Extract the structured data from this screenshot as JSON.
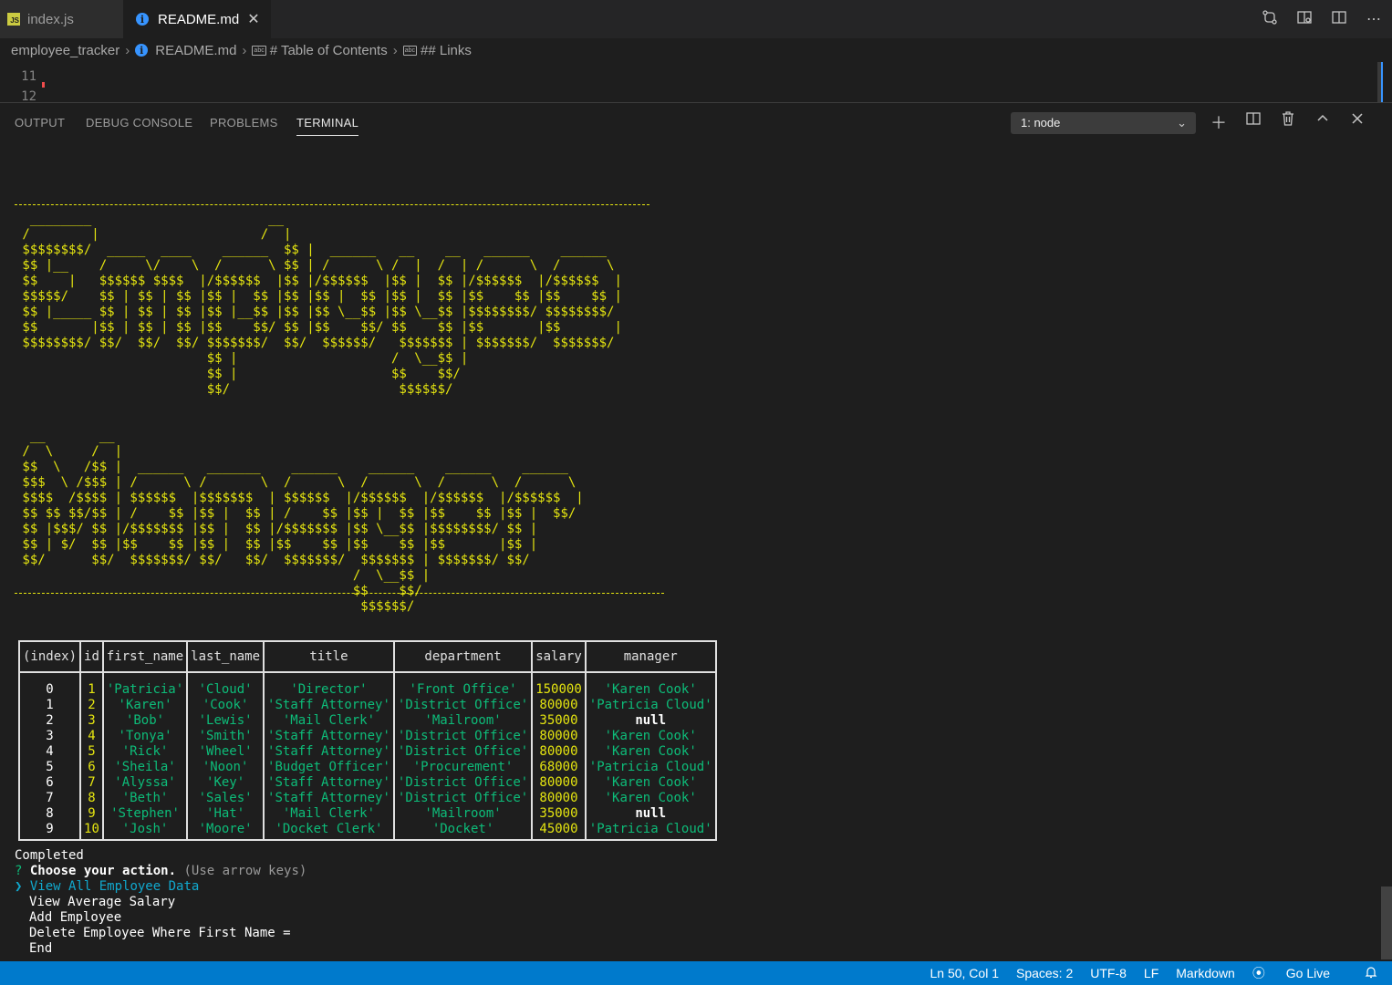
{
  "tabs": [
    {
      "label": "index.js",
      "icon": "js-file-icon"
    },
    {
      "label": "README.md",
      "icon": "info-icon",
      "close": "✕"
    }
  ],
  "breadcrumbs": {
    "folder": "employee_tracker",
    "file": "README.md",
    "section1": "# Table of Contents",
    "section2": "## Links"
  },
  "editor": {
    "line_numbers": [
      "11",
      "12"
    ]
  },
  "panel": {
    "tabs": [
      "OUTPUT",
      "DEBUG CONSOLE",
      "PROBLEMS",
      "TERMINAL"
    ],
    "active_tab": "TERMINAL",
    "terminal_select": "1: node"
  },
  "terminal": {
    "art_lines": [
      "  ________                       __",
      " /        |                     /  |",
      " $$$$$$$$/  _____  ____    ______  $$ |  ______   __    __   ______    ______",
      " $$ |__    /     \\/    \\  /      \\ $$ | /      \\ /  |  /  | /      \\  /      \\",
      " $$    |   $$$$$$ $$$$  |/$$$$$$  |$$ |/$$$$$$  |$$ |  $$ |/$$$$$$  |/$$$$$$  |",
      " $$$$$/    $$ | $$ | $$ |$$ |  $$ |$$ |$$ |  $$ |$$ |  $$ |$$    $$ |$$    $$ |",
      " $$ |_____ $$ | $$ | $$ |$$ |__$$ |$$ |$$ \\__$$ |$$ \\__$$ |$$$$$$$$/ $$$$$$$$/",
      " $$       |$$ | $$ | $$ |$$    $$/ $$ |$$    $$/ $$    $$ |$$       |$$       |",
      " $$$$$$$$/ $$/  $$/  $$/ $$$$$$$/  $$/  $$$$$$/   $$$$$$$ | $$$$$$$/  $$$$$$$/",
      "                         $$ |                    /  \\__$$ |",
      "                         $$ |                    $$    $$/",
      "                         $$/                      $$$$$$/",
      "",
      "",
      "  __       __",
      " /  \\     /  |",
      " $$  \\   /$$ |  ______   _______    ______    ______    ______    ______",
      " $$$  \\ /$$$ | /      \\ /       \\  /      \\  /      \\  /      \\  /      \\",
      " $$$$  /$$$$ | $$$$$$  |$$$$$$$  | $$$$$$  |/$$$$$$  |/$$$$$$  |/$$$$$$  |",
      " $$ $$ $$/$$ | /    $$ |$$ |  $$ | /    $$ |$$ |  $$ |$$    $$ |$$ |  $$/",
      " $$ |$$$/ $$ |/$$$$$$$ |$$ |  $$ |/$$$$$$$ |$$ \\__$$ |$$$$$$$$/ $$ |",
      " $$ | $/  $$ |$$    $$ |$$ |  $$ |$$    $$ |$$    $$ |$$       |$$ |",
      " $$/      $$/  $$$$$$$/ $$/   $$/  $$$$$$$/  $$$$$$$ | $$$$$$$/ $$/",
      "                                            /  \\__$$ |",
      "                                            $$    $$/",
      "                                             $$$$$$/"
    ],
    "table": {
      "headers": [
        "(index)",
        "id",
        "first_name",
        "last_name",
        "title",
        "department",
        "salary",
        "manager"
      ],
      "rows": [
        [
          "0",
          "1",
          "'Patricia'",
          "'Cloud'",
          "'Director'",
          "'Front Office'",
          "150000",
          "'Karen Cook'"
        ],
        [
          "1",
          "2",
          "'Karen'",
          "'Cook'",
          "'Staff Attorney'",
          "'District Office'",
          "80000",
          "'Patricia Cloud'"
        ],
        [
          "2",
          "3",
          "'Bob'",
          "'Lewis'",
          "'Mail Clerk'",
          "'Mailroom'",
          "35000",
          "null"
        ],
        [
          "3",
          "4",
          "'Tonya'",
          "'Smith'",
          "'Staff Attorney'",
          "'District Office'",
          "80000",
          "'Karen Cook'"
        ],
        [
          "4",
          "5",
          "'Rick'",
          "'Wheel'",
          "'Staff Attorney'",
          "'District Office'",
          "80000",
          "'Karen Cook'"
        ],
        [
          "5",
          "6",
          "'Sheila'",
          "'Noon'",
          "'Budget Officer'",
          "'Procurement'",
          "68000",
          "'Patricia Cloud'"
        ],
        [
          "6",
          "7",
          "'Alyssa'",
          "'Key'",
          "'Staff Attorney'",
          "'District Office'",
          "80000",
          "'Karen Cook'"
        ],
        [
          "7",
          "8",
          "'Beth'",
          "'Sales'",
          "'Staff Attorney'",
          "'District Office'",
          "80000",
          "'Karen Cook'"
        ],
        [
          "8",
          "9",
          "'Stephen'",
          "'Hat'",
          "'Mail Clerk'",
          "'Mailroom'",
          "35000",
          "null"
        ],
        [
          "9",
          "10",
          "'Josh'",
          "'Moore'",
          "'Docket Clerk'",
          "'Docket'",
          "45000",
          "'Patricia Cloud'"
        ]
      ]
    },
    "completed": "Completed",
    "prompt_mark": "?",
    "prompt_question": "Choose your action.",
    "prompt_hint": "(Use arrow keys)",
    "pointer": "❯",
    "choices": [
      "View All Employee Data",
      "View Average Salary",
      "Add Employee",
      "Delete Employee Where First Name =",
      "End"
    ]
  },
  "status": {
    "position": "Ln 50, Col 1",
    "spaces": "Spaces: 2",
    "encoding": "UTF-8",
    "eol": "LF",
    "language": "Markdown",
    "live": "Go Live"
  }
}
